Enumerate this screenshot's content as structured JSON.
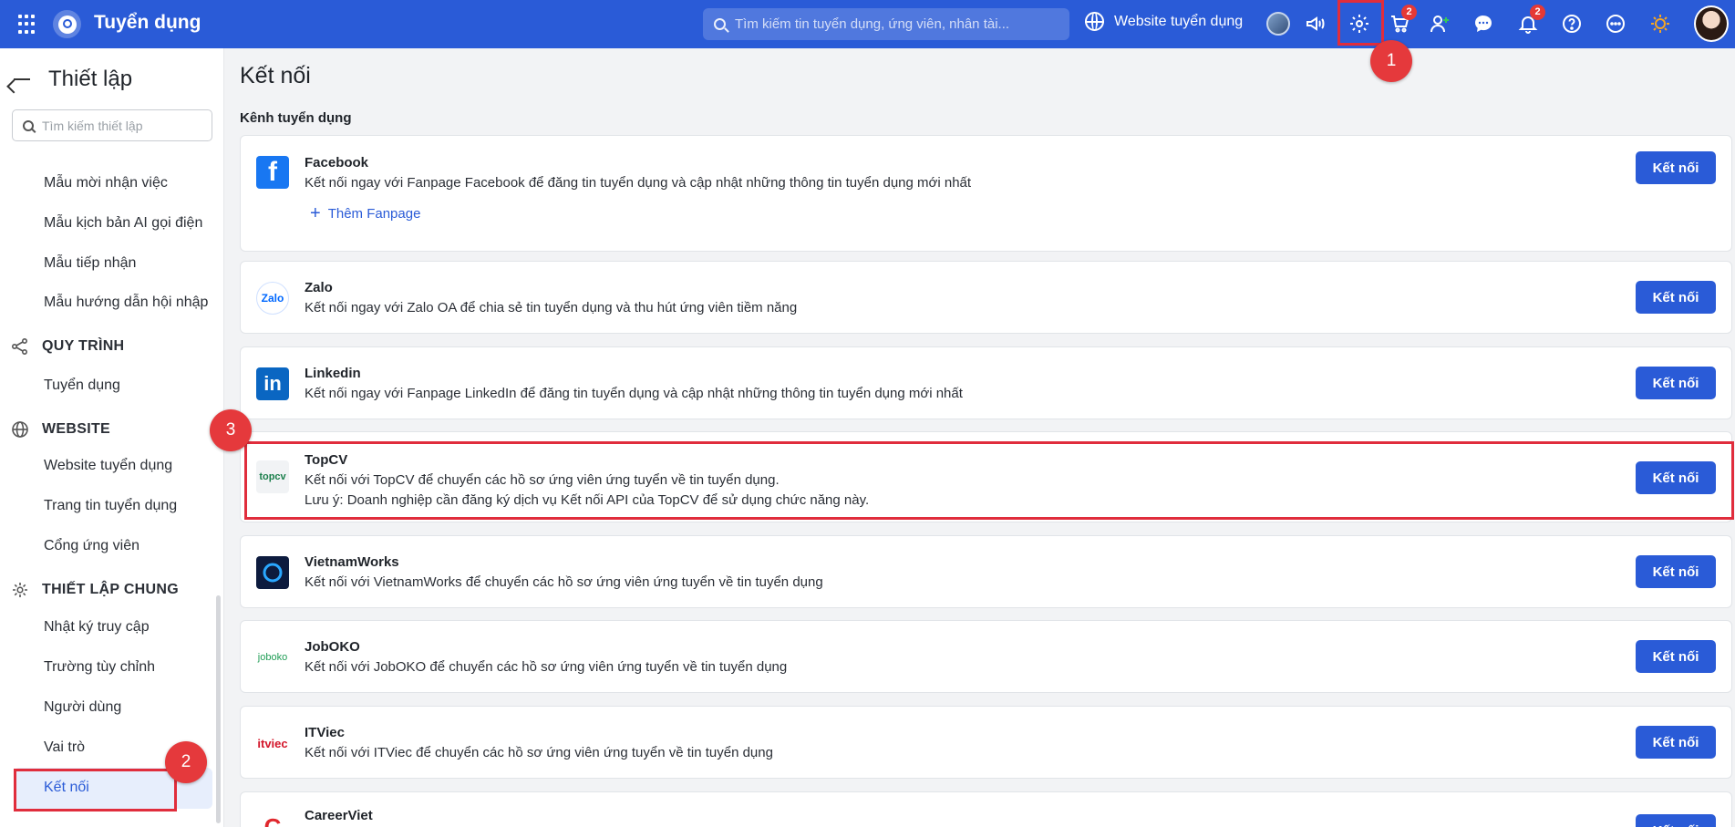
{
  "topbar": {
    "brand": "Tuyển dụng",
    "search_placeholder": "Tìm kiếm tin tuyển dụng, ứng viên, nhân tài...",
    "website_link": "Website tuyển dụng",
    "cart_badge": "2",
    "notification_badge": "2"
  },
  "annotations": [
    "1",
    "2",
    "3"
  ],
  "sidebar": {
    "title": "Thiết lập",
    "search_placeholder": "Tìm kiếm thiết lập",
    "items_top": [
      "Mẫu mời nhận việc",
      "Mẫu kịch bản AI gọi điện",
      "Mẫu tiếp nhận",
      "Mẫu hướng dẫn hội nhập"
    ],
    "section_process": "QUY TRÌNH",
    "process_items": [
      "Tuyển dụng"
    ],
    "section_website": "WEBSITE",
    "website_items": [
      "Website tuyển dụng",
      "Trang tin tuyển dụng",
      "Cổng ứng viên"
    ],
    "section_general": "THIẾT LẬP CHUNG",
    "general_items": [
      "Nhật ký truy cập",
      "Trường tùy chỉnh",
      "Người dùng",
      "Vai trò",
      "Kết nối"
    ]
  },
  "main": {
    "title": "Kết nối",
    "section": "Kênh tuyển dụng",
    "add_fanpage": "Thêm Fanpage",
    "connect_label": "Kết nối",
    "channels": [
      {
        "name": "Facebook",
        "desc": "Kết nối ngay với Fanpage Facebook để đăng tin tuyển dụng và cập nhật những thông tin tuyển dụng mới nhất",
        "logo": "f"
      },
      {
        "name": "Zalo",
        "desc": "Kết nối ngay với Zalo OA để chia sẻ tin tuyển dụng và thu hút ứng viên tiềm năng",
        "logo": "Zalo"
      },
      {
        "name": "Linkedin",
        "desc": "Kết nối ngay với Fanpage LinkedIn để đăng tin tuyển dụng và cập nhật những thông tin tuyển dụng mới nhất",
        "logo": "in"
      },
      {
        "name": "TopCV",
        "desc": "Kết nối với TopCV để chuyển các hồ sơ ứng viên ứng tuyển về tin tuyển dụng.",
        "note": "Lưu ý: Doanh nghiệp cần đăng ký dịch vụ Kết nối API của TopCV để sử dụng chức năng này.",
        "logo": "topcv"
      },
      {
        "name": "VietnamWorks",
        "desc": "Kết nối với VietnamWorks để chuyển các hồ sơ ứng viên ứng tuyển về tin tuyển dụng",
        "logo": ""
      },
      {
        "name": "JobOKO",
        "desc": "Kết nối với JobOKO để chuyển các hồ sơ ứng viên ứng tuyển về tin tuyển dụng",
        "logo": "joboko"
      },
      {
        "name": "ITViec",
        "desc": "Kết nối với ITViec để chuyển các hồ sơ ứng viên ứng tuyển về tin tuyển dụng",
        "logo": "itviec"
      },
      {
        "name": "CareerViet",
        "desc": "",
        "logo": "C"
      }
    ]
  },
  "colors": {
    "primary": "#2a5bd7",
    "annotation": "#e02d3c",
    "active_bg": "#e7eefc"
  }
}
